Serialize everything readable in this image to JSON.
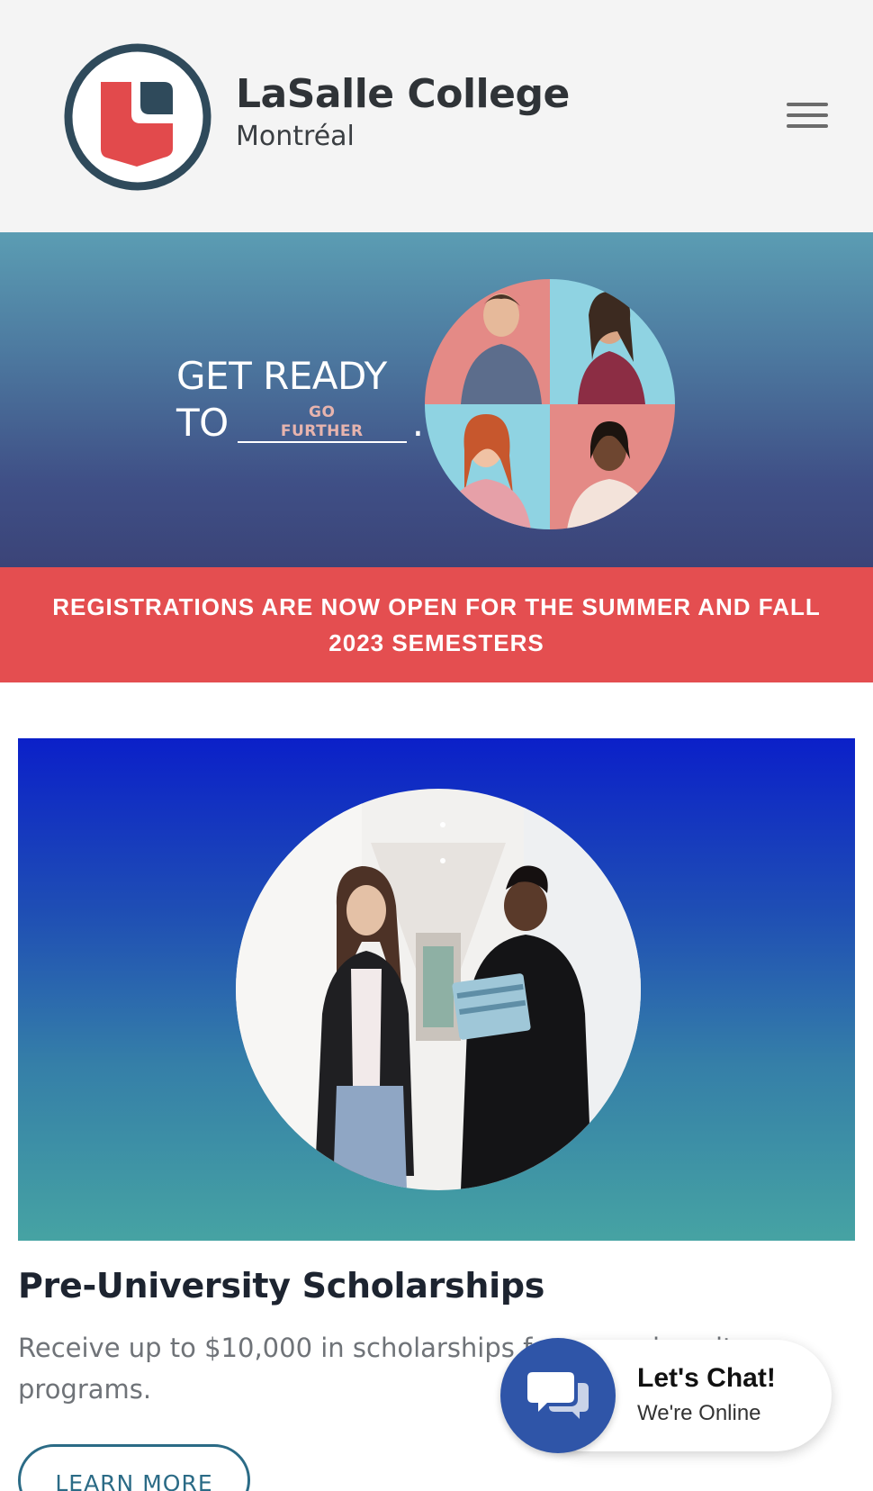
{
  "header": {
    "logo_name": "LaSalle College",
    "logo_city": "Montréal",
    "menu_icon": "hamburger-menu-icon"
  },
  "hero": {
    "line1": "GET READY",
    "line2_prefix": "TO",
    "blank_line1": "GO",
    "blank_line2": "FURTHER",
    "period": "."
  },
  "banner": {
    "text": "REGISTRATIONS ARE NOW OPEN FOR THE SUMMER AND FALL 2023 SEMESTERS"
  },
  "card": {
    "title": "Pre-University Scholarships",
    "description": "Receive up to $10,000 in scholarships for pre-university programs.",
    "button": "LEARN MORE"
  },
  "chat": {
    "title": "Let's Chat!",
    "status": "We're Online",
    "icon": "chat-bubbles-icon"
  },
  "colors": {
    "brand_red": "#e44e50",
    "brand_navy": "#2f4a5b",
    "button_teal": "#2b6b86",
    "chat_blue": "#2f55a8"
  }
}
